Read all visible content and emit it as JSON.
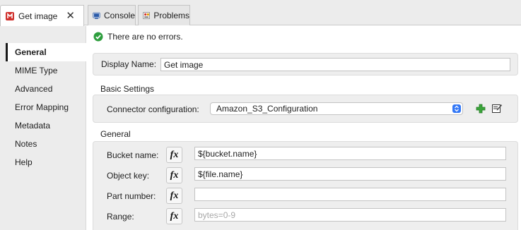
{
  "tabs": [
    {
      "label": "Get image",
      "icon": "mule-connector-icon",
      "active": true
    },
    {
      "label": "Console",
      "icon": "console-icon"
    },
    {
      "label": "Problems",
      "icon": "problems-icon"
    }
  ],
  "nav": {
    "items": [
      "General",
      "MIME Type",
      "Advanced",
      "Error Mapping",
      "Metadata",
      "Notes",
      "Help"
    ],
    "active": "General"
  },
  "status": {
    "text": "There are no errors.",
    "icon": "check-circle-icon",
    "color": "#2e9e3e"
  },
  "display_name": {
    "label": "Display Name:",
    "value": "Get image"
  },
  "basic_settings": {
    "title": "Basic Settings",
    "connector_label": "Connector configuration:",
    "connector_value": "Amazon_S3_Configuration",
    "add_icon": "add-plus-icon",
    "edit_icon": "edit-icon"
  },
  "general": {
    "title": "General",
    "fields": [
      {
        "label": "Bucket name:",
        "value": "${bucket.name}",
        "placeholder": ""
      },
      {
        "label": "Object key:",
        "value": "${file.name}",
        "placeholder": ""
      },
      {
        "label": "Part number:",
        "value": "",
        "placeholder": ""
      },
      {
        "label": "Range:",
        "value": "",
        "placeholder": "bytes=0-9"
      }
    ],
    "fx_label": "fx"
  },
  "colors": {
    "accent": "#3478f6",
    "ok_green": "#2e9e3e",
    "plus_green": "#3aa53a"
  }
}
